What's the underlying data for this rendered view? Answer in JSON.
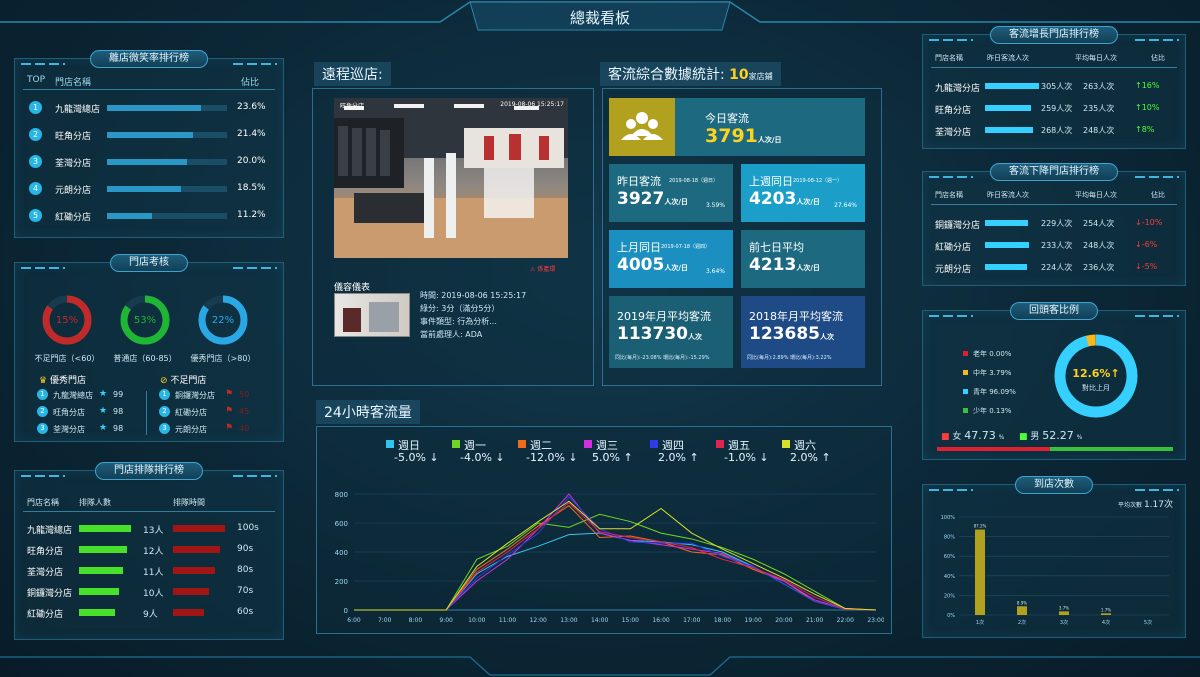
{
  "header": {
    "title": "總裁看板"
  },
  "smile_rank": {
    "title": "離店微笑率排行榜",
    "col_top": "TOP",
    "col_name": "門店名稱",
    "col_pct": "佔比",
    "rows": [
      {
        "rank": "1",
        "name": "九龍灣總店",
        "pct": "23.6%",
        "fill": 0.236
      },
      {
        "rank": "2",
        "name": "旺角分店",
        "pct": "21.4%",
        "fill": 0.214
      },
      {
        "rank": "3",
        "name": "荃灣分店",
        "pct": "20.0%",
        "fill": 0.2
      },
      {
        "rank": "4",
        "name": "元朗分店",
        "pct": "18.5%",
        "fill": 0.185
      },
      {
        "rank": "5",
        "name": "紅磡分店",
        "pct": "11.2%",
        "fill": 0.112
      }
    ]
  },
  "assess": {
    "title": "門店考核",
    "donuts": [
      {
        "label": "不足門店（<60）",
        "value": "15%",
        "fill": 0.15,
        "color": "#c02a2a"
      },
      {
        "label": "普通店（60-85）",
        "value": "53%",
        "fill": 0.53,
        "color": "#1fb535"
      },
      {
        "label": "優秀門店（>80）",
        "value": "22%",
        "fill": 0.22,
        "color": "#2aa8e6"
      }
    ],
    "excellent_title": "優秀門店",
    "poor_title": "不足門店",
    "excellent": [
      {
        "rank": "1",
        "name": "九龍灣總店",
        "score": "99"
      },
      {
        "rank": "2",
        "name": "旺角分店",
        "score": "98"
      },
      {
        "rank": "3",
        "name": "荃灣分店",
        "score": "98"
      }
    ],
    "poor": [
      {
        "rank": "1",
        "name": "銅鑼灣分店",
        "score": "50"
      },
      {
        "rank": "2",
        "name": "紅磡分店",
        "score": "45"
      },
      {
        "rank": "3",
        "name": "元朗分店",
        "score": "40"
      }
    ]
  },
  "queue": {
    "title": "門店排隊排行榜",
    "col_name": "門店名稱",
    "col_count": "排隊人數",
    "col_time": "排隊時間",
    "rows": [
      {
        "name": "九龍灣總店",
        "count": "13人",
        "time": "100s",
        "cf": 1.0,
        "tf": 1.0
      },
      {
        "name": "旺角分店",
        "count": "12人",
        "time": "90s",
        "cf": 0.92,
        "tf": 0.9
      },
      {
        "name": "荃灣分店",
        "count": "11人",
        "time": "80s",
        "cf": 0.85,
        "tf": 0.8
      },
      {
        "name": "銅鑼灣分店",
        "count": "10人",
        "time": "70s",
        "cf": 0.77,
        "tf": 0.7
      },
      {
        "name": "紅磡分店",
        "count": "9人",
        "time": "60s",
        "cf": 0.69,
        "tf": 0.6
      }
    ]
  },
  "patrol": {
    "title": "遠程巡店:",
    "cam_label": "旺角分店",
    "cam_time": "2019-08-06 15:25:17",
    "alert": "係產環",
    "event_title": "儀容儀表",
    "event": [
      {
        "k": "時間:",
        "v": "2019-08-06 15:25:17"
      },
      {
        "k": "綠分:",
        "v": "3分（滿分5分）"
      },
      {
        "k": "事件類型:",
        "v": "行為分析..."
      },
      {
        "k": "當前處理人:",
        "v": "ADA"
      }
    ]
  },
  "traffic": {
    "title": "客流綜合數據統計:",
    "count": "10",
    "count_unit": "家店鋪",
    "today": {
      "label": "今日客流",
      "value": "3791",
      "unit": "人次/日"
    },
    "yesterday": {
      "label": "昨日客流",
      "date": "2019-08-18（週日）",
      "value": "3927",
      "unit": "人次/日",
      "pct": "3.59%"
    },
    "lastweek": {
      "label": "上週同日",
      "date": "2019-08-12（週一）",
      "value": "4203",
      "unit": "人次/日",
      "pct": "27.64%"
    },
    "lastmonth": {
      "label": "上月同日",
      "date": "2019-07-18（週四）",
      "value": "4005",
      "unit": "人次/日",
      "pct": "3.64%"
    },
    "avg7": {
      "label": "前七日平均",
      "value": "4213",
      "unit": "人次/日"
    },
    "y2019": {
      "label": "2019年月平均客流",
      "value": "113730",
      "unit": "人次",
      "yoy": "同比(每月):-23.08%",
      "mom": "環比(每月):-15.29%"
    },
    "y2018": {
      "label": "2018年月平均客流",
      "value": "123685",
      "unit": "人次",
      "yoy": "同比(每月):2.89%",
      "mom": "環比(每月):3.22%"
    }
  },
  "hourly": {
    "title": "24小時客流量",
    "legend": [
      {
        "name": "週日",
        "pct": "-5.0%",
        "arrow": "↓",
        "color": "#34c3f0"
      },
      {
        "name": "週一",
        "pct": "-4.0%",
        "arrow": "↓",
        "color": "#6fd624"
      },
      {
        "name": "週二",
        "pct": "-12.0%",
        "arrow": "↓",
        "color": "#f06a1e"
      },
      {
        "name": "週三",
        "pct": "5.0%",
        "arrow": "↑",
        "color": "#d42ee0"
      },
      {
        "name": "週四",
        "pct": "2.0%",
        "arrow": "↑",
        "color": "#2d3ee8"
      },
      {
        "name": "週五",
        "pct": "-1.0%",
        "arrow": "↓",
        "color": "#e0244e"
      },
      {
        "name": "週六",
        "pct": "2.0%",
        "arrow": "↑",
        "color": "#d8e02a"
      }
    ]
  },
  "chart_data": {
    "type": "line",
    "x": [
      "6:00",
      "7:00",
      "8:00",
      "9:00",
      "10:00",
      "11:00",
      "12:00",
      "13:00",
      "14:00",
      "15:00",
      "16:00",
      "17:00",
      "18:00",
      "19:00",
      "20:00",
      "21:00",
      "22:00",
      "23:00"
    ],
    "ylim": [
      0,
      800
    ],
    "yticks": [
      "0",
      "200",
      "400",
      "600",
      "800"
    ],
    "series": [
      {
        "name": "週日",
        "values": [
          0,
          0,
          0,
          0,
          250,
          370,
          440,
          520,
          530,
          480,
          470,
          450,
          400,
          300,
          180,
          60,
          5,
          0
        ]
      },
      {
        "name": "週一",
        "values": [
          0,
          0,
          0,
          0,
          350,
          440,
          600,
          570,
          660,
          610,
          530,
          490,
          430,
          350,
          250,
          130,
          10,
          0
        ]
      },
      {
        "name": "週二",
        "values": [
          0,
          0,
          0,
          0,
          280,
          420,
          580,
          720,
          500,
          510,
          470,
          400,
          380,
          280,
          200,
          60,
          5,
          0
        ]
      },
      {
        "name": "週三",
        "values": [
          0,
          0,
          0,
          0,
          200,
          350,
          560,
          800,
          530,
          480,
          450,
          420,
          390,
          290,
          200,
          70,
          5,
          0
        ]
      },
      {
        "name": "週四",
        "values": [
          0,
          0,
          0,
          0,
          220,
          380,
          530,
          780,
          560,
          470,
          460,
          460,
          370,
          300,
          180,
          60,
          5,
          0
        ]
      },
      {
        "name": "週五",
        "values": [
          0,
          0,
          0,
          0,
          260,
          400,
          560,
          740,
          540,
          500,
          470,
          430,
          350,
          290,
          210,
          90,
          5,
          0
        ]
      },
      {
        "name": "週六",
        "values": [
          0,
          0,
          0,
          0,
          300,
          460,
          610,
          750,
          560,
          560,
          700,
          530,
          420,
          320,
          220,
          110,
          10,
          0
        ]
      }
    ]
  },
  "growth": {
    "title": "客流增長門店排行榜",
    "col_name": "門店名稱",
    "col_yest": "昨日客流人次",
    "col_avg": "平均每日人次",
    "col_pct": "佔比",
    "rows": [
      {
        "name": "九龍灣分店",
        "yest": "305人次",
        "avg": "263人次",
        "pct": "16%",
        "arrow": "↑",
        "fill": 1.0
      },
      {
        "name": "旺角分店",
        "yest": "259人次",
        "avg": "235人次",
        "pct": "10%",
        "arrow": "↑",
        "fill": 0.85
      },
      {
        "name": "荃灣分店",
        "yest": "268人次",
        "avg": "248人次",
        "pct": "8%",
        "arrow": "↑",
        "fill": 0.88
      }
    ]
  },
  "decline": {
    "title": "客流下降門店排行榜",
    "col_name": "門店名稱",
    "col_yest": "昨日客流人次",
    "col_avg": "平均每日人次",
    "col_pct": "佔比",
    "rows": [
      {
        "name": "銅鑼灣分店",
        "yest": "229人次",
        "avg": "254人次",
        "pct": "-10%",
        "arrow": "↓",
        "fill": 0.8
      },
      {
        "name": "紅磡分店",
        "yest": "233人次",
        "avg": "248人次",
        "pct": "-6%",
        "arrow": "↓",
        "fill": 0.82
      },
      {
        "name": "元朗分店",
        "yest": "224人次",
        "avg": "236人次",
        "pct": "-5%",
        "arrow": "↓",
        "fill": 0.78
      }
    ]
  },
  "repeat": {
    "title": "回頭客比例",
    "legend": [
      {
        "name": "老年 0.00%",
        "color": "#e02030"
      },
      {
        "name": "中年 3.79%",
        "color": "#f5b820"
      },
      {
        "name": "青年 96.09%",
        "color": "#35d0ff"
      },
      {
        "name": "少年 0.13%",
        "color": "#37c23b"
      }
    ],
    "center_value": "12.6%",
    "center_arrow": "↑",
    "center_label": "對比上月",
    "ring_fill": 0.9609,
    "female_label": "女",
    "female": "47.73",
    "male_label": "男",
    "male": "52.27",
    "percent": "%",
    "female_fill": 0.4773
  },
  "visits": {
    "title": "到店次數",
    "avg_label": "平均次數",
    "avg": "1.17次",
    "yticks": [
      "0%",
      "20%",
      "40%",
      "60%",
      "80%",
      "100%"
    ],
    "categories": [
      "1次",
      "2次",
      "3次",
      "4次",
      "5次"
    ],
    "values": [
      87.2,
      8.9,
      3.7,
      1.7,
      0
    ],
    "labels": [
      "87.2%",
      "8.9%",
      "3.7%",
      "1.7%",
      ""
    ]
  }
}
